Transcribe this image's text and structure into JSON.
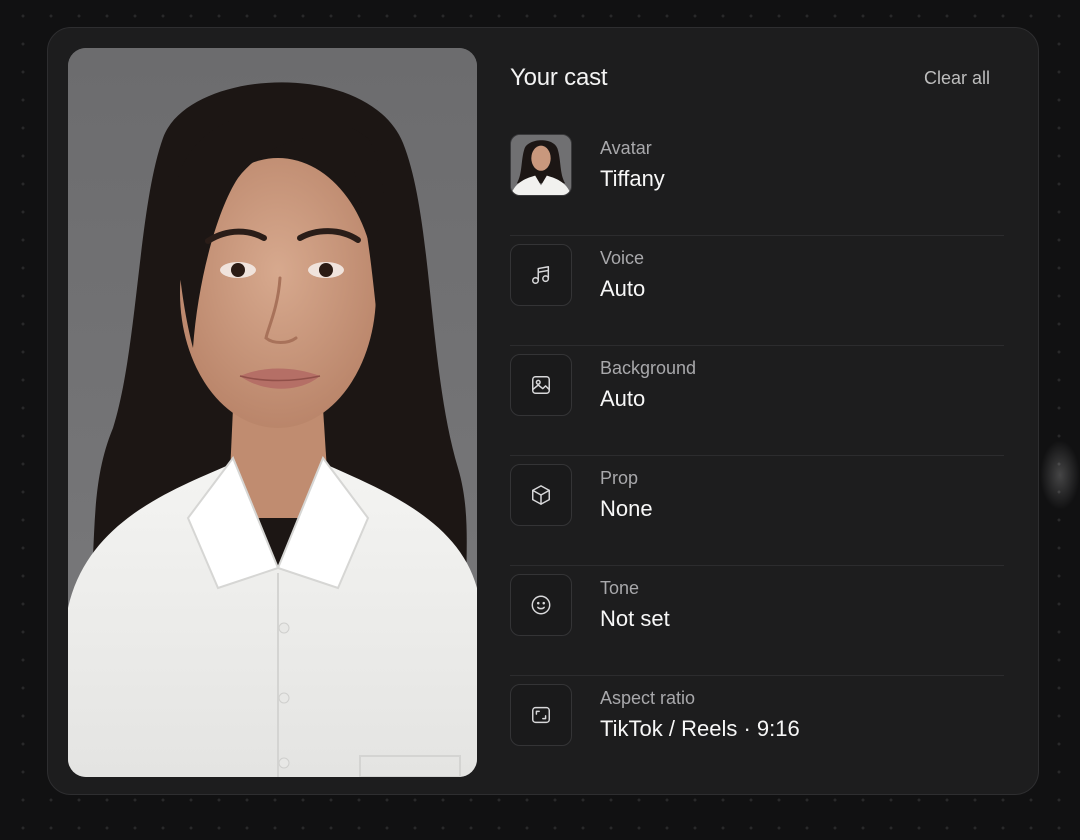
{
  "cast_panel": {
    "title": "Your cast",
    "clear_all_label": "Clear all",
    "items": [
      {
        "label": "Avatar",
        "value": "Tiffany",
        "icon": "avatar-thumbnail"
      },
      {
        "label": "Voice",
        "value": "Auto",
        "icon": "music-note-icon"
      },
      {
        "label": "Background",
        "value": "Auto",
        "icon": "image-icon"
      },
      {
        "label": "Prop",
        "value": "None",
        "icon": "cube-icon"
      },
      {
        "label": "Tone",
        "value": "Not set",
        "icon": "smiley-icon"
      },
      {
        "label": "Aspect ratio",
        "value": "TikTok / Reels · 9:16",
        "icon": "aspect-ratio-icon"
      }
    ]
  },
  "colors": {
    "page_background": "#111112",
    "card_background": "#1d1d1e",
    "label_text": "#a8a8ab",
    "value_text": "#f7f7f7",
    "divider": "#2c2c2e"
  }
}
